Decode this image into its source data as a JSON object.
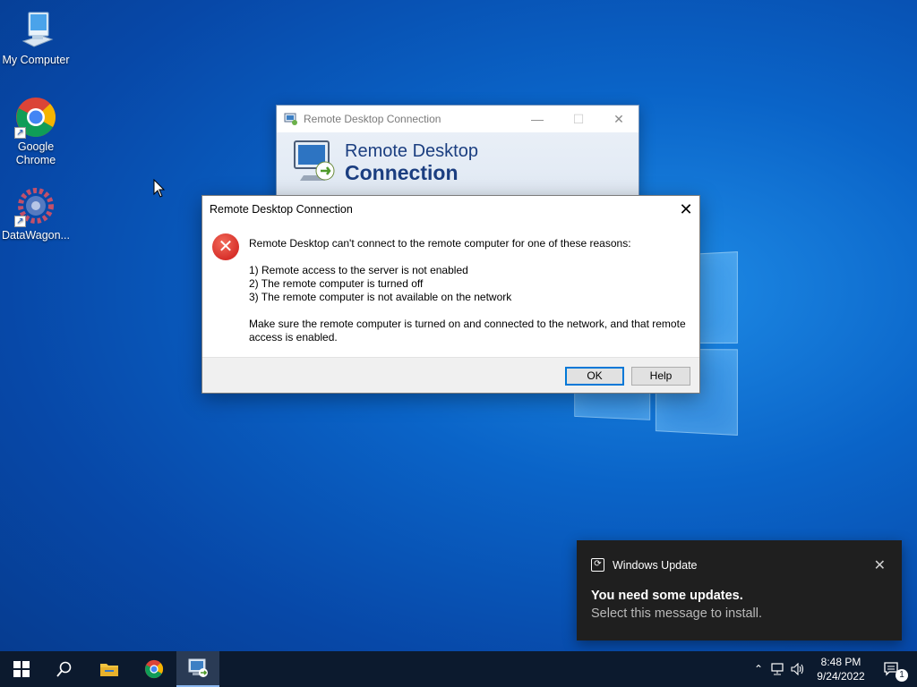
{
  "desktop": {
    "icons": [
      {
        "label": "My Computer",
        "icon": "computer-icon"
      },
      {
        "label": "Google Chrome",
        "icon": "chrome-icon"
      },
      {
        "label": "DataWagon...",
        "icon": "gear-icon"
      }
    ]
  },
  "rdc_window": {
    "title": "Remote Desktop Connection",
    "banner_line1": "Remote Desktop",
    "banner_line2": "Connection",
    "minimize": "—",
    "maximize": "☐",
    "close": "✕"
  },
  "dialog": {
    "title": "Remote Desktop Connection",
    "close": "✕",
    "icon": "error-icon",
    "intro": "Remote Desktop can't connect to the remote computer for one of these reasons:",
    "reasons": [
      "1) Remote access to the server is not enabled",
      "2) The remote computer is turned off",
      "3) The remote computer is not available on the network"
    ],
    "advice": "Make sure the remote computer is turned on and connected to the network, and that remote access is enabled.",
    "ok_label": "OK",
    "help_label": "Help"
  },
  "toast": {
    "app": "Windows Update",
    "title": "You need some updates.",
    "message": "Select this message to install.",
    "close": "✕"
  },
  "taskbar": {
    "items": [
      "start-icon",
      "search-icon",
      "file-explorer-icon",
      "chrome-icon",
      "remote-desktop-icon"
    ],
    "time": "8:48 PM",
    "date": "9/24/2022",
    "notification_count": "1"
  },
  "colors": {
    "accent": "#0078d7",
    "error": "#d7302a",
    "taskbar": "#0c1a2e",
    "toast_bg": "#1f1f1f"
  }
}
